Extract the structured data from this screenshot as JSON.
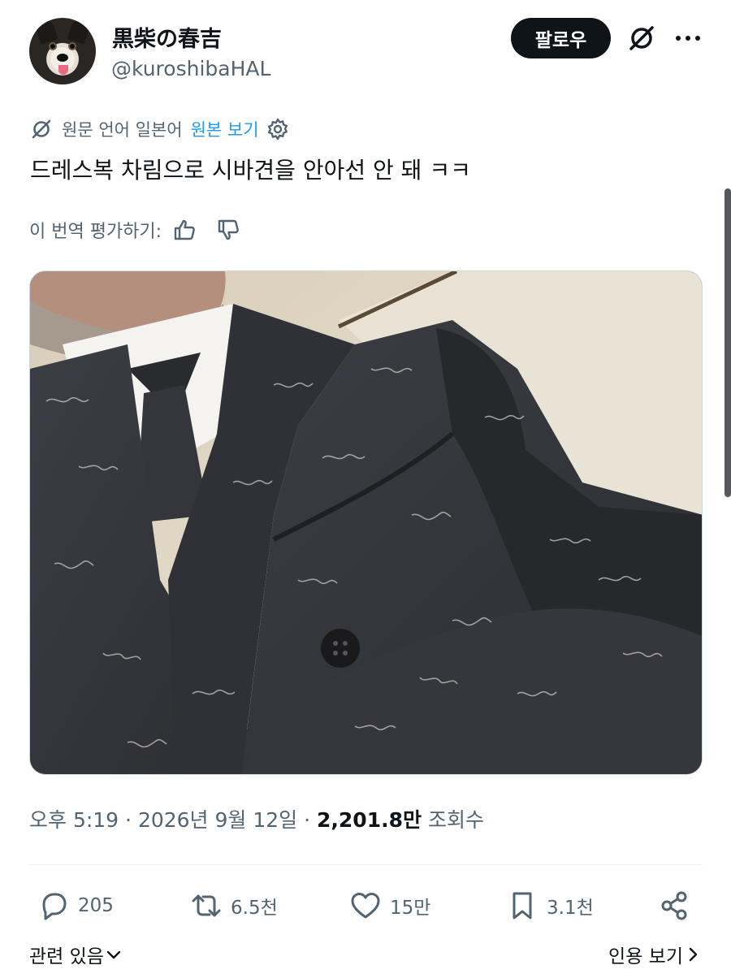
{
  "author": {
    "display_name": "黒柴の春吉",
    "handle": "@kuroshibaHAL",
    "avatar_icon": "shiba-dog-avatar"
  },
  "header": {
    "follow_label": "팔로우",
    "translate_icon": "translate-icon",
    "more_icon": "more-icon"
  },
  "translation": {
    "source_lang_text": "원문 언어 일본어",
    "view_original_label": "원본 보기",
    "settings_icon": "gear-icon",
    "link_color": "#1d9bf0"
  },
  "tweet": {
    "text": "드레스복 차림으로 시바견을 안아선 안 돼 ㅋㅋ"
  },
  "rating": {
    "prompt": "이 번역 평가하기:",
    "up_icon": "thumbs-up-icon",
    "down_icon": "thumbs-down-icon"
  },
  "meta": {
    "time": "오후 5:19",
    "sep1": " · ",
    "date": "2026년 9월 12일",
    "sep2": " · ",
    "views_count": "2,201.8만",
    "views_label": " 조회수"
  },
  "actions": {
    "replies": "205",
    "reposts": "6.5천",
    "likes": "15만",
    "bookmarks": "3.1천"
  },
  "footer": {
    "related_label": "관련 있음",
    "quotes_label": "인용 보기"
  }
}
